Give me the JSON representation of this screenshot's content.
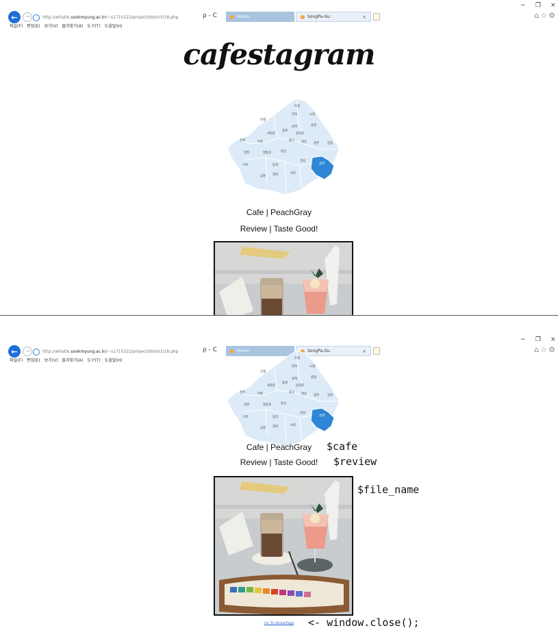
{
  "browser": {
    "url_prefix": "http://whistle.",
    "url_host": "sookmyung.ac.kr",
    "url_path": "/~s1710222/project/district/18.php",
    "search_refresh": "ρ - C",
    "tabs": [
      {
        "label": "Home",
        "active": true
      },
      {
        "label": "SongPa-Gu",
        "active": false
      }
    ],
    "tab_close": "×",
    "window_controls": {
      "minimize": "−",
      "restore": "❐",
      "close": "×"
    },
    "right_icons": "⌂☆⚙",
    "menu": [
      "파일(F)",
      "편집(E)",
      "보기(V)",
      "즐겨찾기(A)",
      "도구(T)",
      "도움말(H)"
    ]
  },
  "page": {
    "logo": "cafestagram",
    "cafe_line": "Cafe | PeachGray",
    "review_line": "Review | Taste Good!",
    "home_link": "Go To HomePage",
    "map_districts": [
      "도봉",
      "강북",
      "노원",
      "은평",
      "성북",
      "중랑",
      "서대문",
      "종로",
      "동대문",
      "강서",
      "마포",
      "중구",
      "성동",
      "광진",
      "강동",
      "양천",
      "영등포",
      "용산",
      "송파",
      "구로",
      "동작",
      "강남",
      "서초",
      "금천",
      "관악"
    ],
    "highlighted_district": "송파"
  },
  "annotations": {
    "cafe": "$cafe",
    "review": "$review",
    "file_name": "$file_name",
    "close": "<- window.close();"
  },
  "colors": {
    "map_fill": "#dcebf7",
    "map_stroke": "#ffffff",
    "map_highlight": "#2f86d6",
    "back_button": "#1e6fd9",
    "active_tab": "#a9c4de",
    "link": "#2255cc"
  }
}
